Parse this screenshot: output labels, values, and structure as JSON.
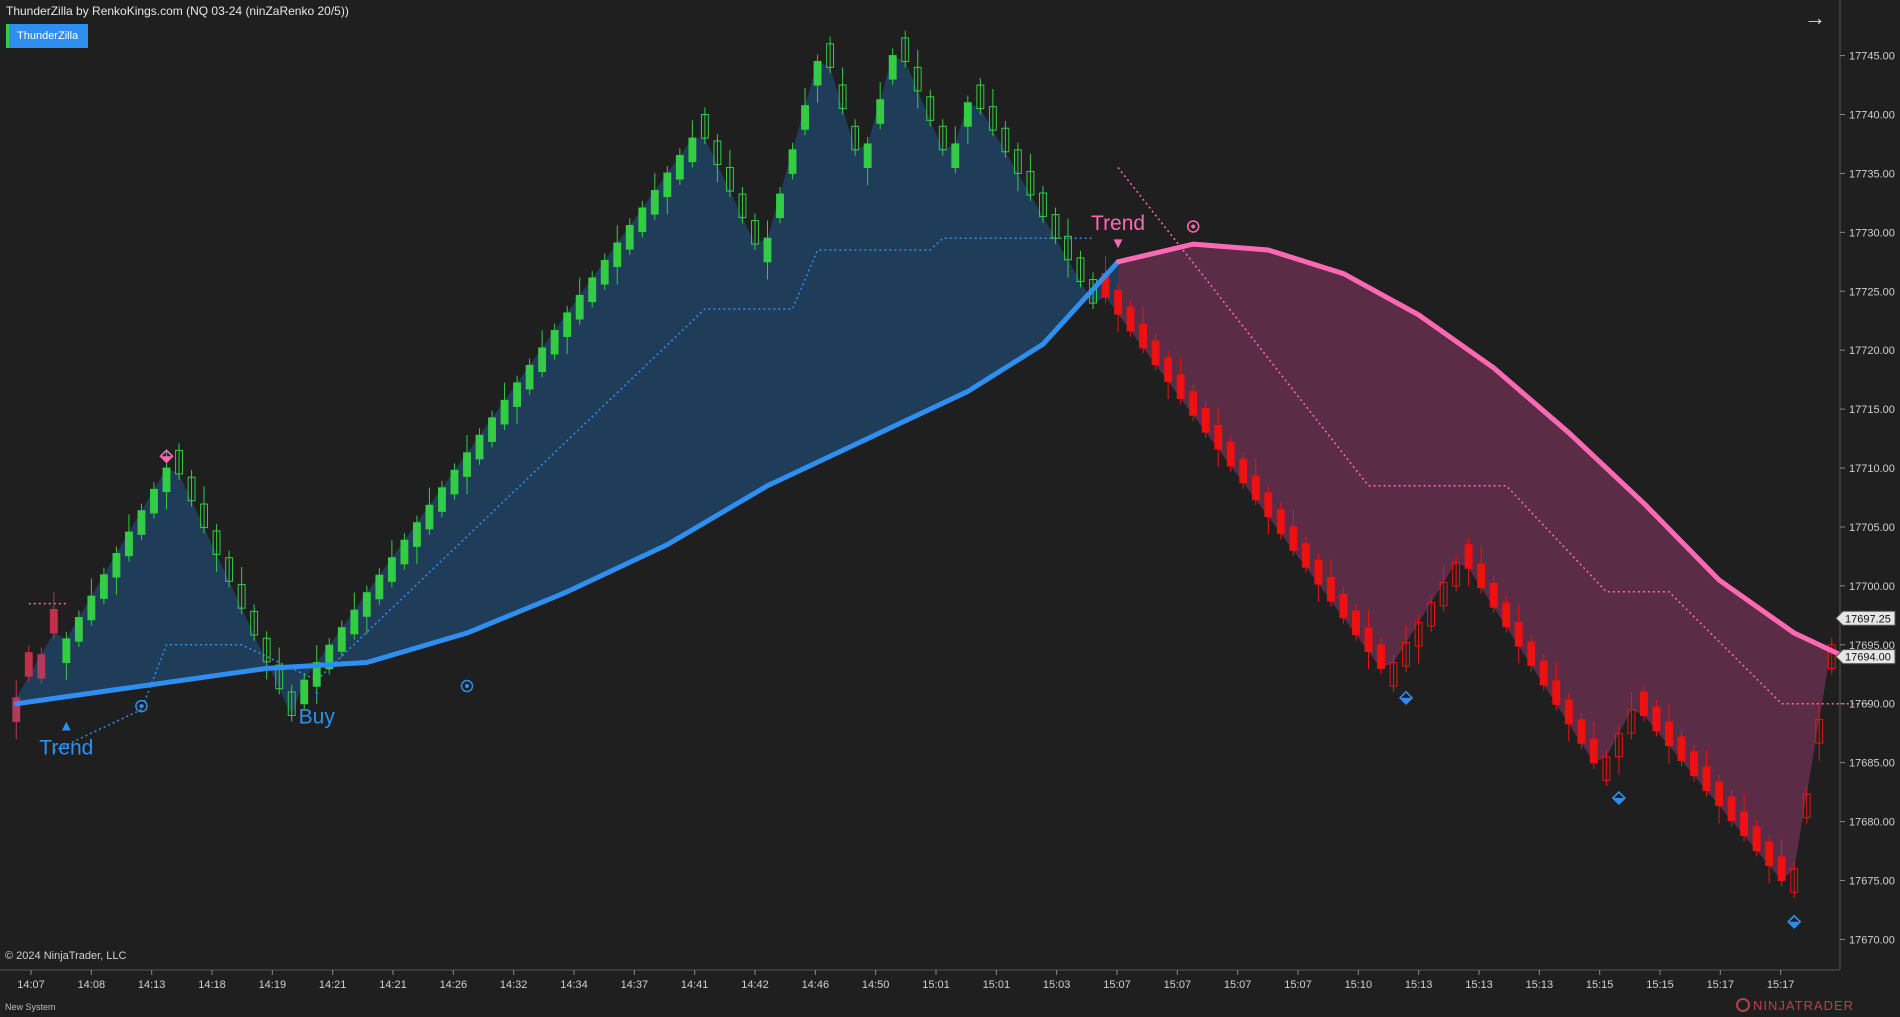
{
  "header": {
    "title": "ThunderZilla by RenkoKings.com (NQ 03-24 (ninZaRenko 20/5))",
    "indicator_badge": "ThunderZilla"
  },
  "footer": {
    "copyright": "© 2024 NinjaTrader, LLC",
    "system": "New System",
    "logo": "NINJATRADER"
  },
  "colors": {
    "background": "#1f1f1f",
    "up_bar": "#33cc44",
    "down_bar": "#ee1111",
    "bull_line": "#2f8ff0",
    "bear_line": "#ff69b4",
    "bull_fill": "#1f4468",
    "bear_fill": "#6a3050"
  },
  "chart_data": {
    "type": "candlestick-renko",
    "y_axis": {
      "ticks": [
        17745.0,
        17740.0,
        17735.0,
        17730.0,
        17725.0,
        17720.0,
        17715.0,
        17710.0,
        17705.0,
        17700.0,
        17695.0,
        17690.0,
        17685.0,
        17680.0,
        17675.0,
        17670.0
      ],
      "ylim": [
        17668.0,
        17747.0
      ]
    },
    "price_labels": [
      {
        "value": 17697.25,
        "text": "17697.25"
      },
      {
        "value": 17694.0,
        "text": "17694.00"
      }
    ],
    "x_axis": {
      "tick_labels": [
        "14:07",
        "14:08",
        "14:13",
        "14:18",
        "14:19",
        "14:21",
        "14:21",
        "14:26",
        "14:32",
        "14:34",
        "14:37",
        "14:41",
        "14:42",
        "14:46",
        "14:50",
        "15:01",
        "15:01",
        "15:03",
        "15:07",
        "15:07",
        "15:07",
        "15:07",
        "15:10",
        "15:13",
        "15:13",
        "15:13",
        "15:15",
        "15:15",
        "15:17",
        "15:17"
      ]
    },
    "bars": {
      "count": 146,
      "segments": [
        {
          "from": 0,
          "to": 3,
          "start": 17690.5,
          "end": 17696.0,
          "dir": "mix"
        },
        {
          "from": 4,
          "to": 12,
          "start": 17695.5,
          "end": 17710.0,
          "dir": "up"
        },
        {
          "from": 13,
          "to": 22,
          "start": 17709.5,
          "end": 17689.0,
          "dir": "down-hollow"
        },
        {
          "from": 23,
          "to": 54,
          "start": 17692.0,
          "end": 17738.0,
          "dir": "up"
        },
        {
          "from": 55,
          "to": 59,
          "start": 17738.0,
          "end": 17729.0,
          "dir": "down-hollow"
        },
        {
          "from": 60,
          "to": 64,
          "start": 17729.5,
          "end": 17744.5,
          "dir": "up"
        },
        {
          "from": 65,
          "to": 67,
          "start": 17744.0,
          "end": 17737.0,
          "dir": "down-hollow"
        },
        {
          "from": 68,
          "to": 70,
          "start": 17737.5,
          "end": 17745.0,
          "dir": "up"
        },
        {
          "from": 71,
          "to": 74,
          "start": 17744.5,
          "end": 17737.0,
          "dir": "down-hollow"
        },
        {
          "from": 75,
          "to": 76,
          "start": 17737.5,
          "end": 17741.0,
          "dir": "up"
        },
        {
          "from": 77,
          "to": 86,
          "start": 17740.5,
          "end": 17724.0,
          "dir": "down-hollow"
        },
        {
          "from": 87,
          "to": 109,
          "start": 17724.5,
          "end": 17693.0,
          "dir": "down"
        },
        {
          "from": 110,
          "to": 115,
          "start": 17693.5,
          "end": 17702.0,
          "dir": "up-hollow-red"
        },
        {
          "from": 116,
          "to": 126,
          "start": 17701.5,
          "end": 17685.0,
          "dir": "down"
        },
        {
          "from": 127,
          "to": 129,
          "start": 17685.5,
          "end": 17689.5,
          "dir": "up-hollow-red"
        },
        {
          "from": 130,
          "to": 141,
          "start": 17689.0,
          "end": 17675.0,
          "dir": "down"
        },
        {
          "from": 142,
          "to": 145,
          "start": 17676.0,
          "end": 17695.0,
          "dir": "up-hollow-red"
        }
      ]
    },
    "trend_line": {
      "bull": {
        "from_bar": 0,
        "to_bar": 88,
        "points": [
          [
            0,
            17690.0
          ],
          [
            10,
            17691.5
          ],
          [
            20,
            17693.0
          ],
          [
            28,
            17693.5
          ],
          [
            36,
            17696.0
          ],
          [
            44,
            17699.5
          ],
          [
            52,
            17703.5
          ],
          [
            60,
            17708.5
          ],
          [
            68,
            17712.5
          ],
          [
            76,
            17716.5
          ],
          [
            82,
            17720.5
          ],
          [
            88,
            17727.5
          ]
        ]
      },
      "bear": {
        "from_bar": 88,
        "to_bar": 146,
        "points": [
          [
            88,
            17727.5
          ],
          [
            94,
            17729.0
          ],
          [
            100,
            17728.5
          ],
          [
            106,
            17726.5
          ],
          [
            112,
            17723.0
          ],
          [
            118,
            17718.5
          ],
          [
            124,
            17713.0
          ],
          [
            130,
            17707.0
          ],
          [
            136,
            17700.5
          ],
          [
            142,
            17696.0
          ],
          [
            146,
            17694.0
          ]
        ]
      }
    },
    "stop_lines": {
      "bull_dotted": [
        [
          3,
          17686.0
        ],
        [
          10,
          17689.5
        ],
        [
          12,
          17695.0
        ],
        [
          18,
          17695.0
        ],
        [
          24,
          17692.0
        ],
        [
          55,
          17723.5
        ],
        [
          62,
          17723.5
        ],
        [
          64,
          17728.5
        ],
        [
          73,
          17728.5
        ],
        [
          74,
          17729.5
        ],
        [
          86,
          17729.5
        ]
      ],
      "bear_dotted": [
        [
          88,
          17735.5
        ],
        [
          108,
          17708.5
        ],
        [
          119,
          17708.5
        ],
        [
          127,
          17699.5
        ],
        [
          132,
          17699.5
        ],
        [
          141,
          17690.0
        ],
        [
          148,
          17690.0
        ]
      ],
      "short_pink": [
        [
          1,
          17698.5
        ],
        [
          4,
          17698.5
        ]
      ]
    },
    "signals": [
      {
        "label": "Trend",
        "bar": 4,
        "direction": "up",
        "color": "#2f8ff0"
      },
      {
        "label": "Buy",
        "bar": 24,
        "direction": "up",
        "color": "#2f8ff0"
      },
      {
        "label": "Trend",
        "bar": 88,
        "direction": "down",
        "color": "#ff69b4"
      }
    ],
    "markers": [
      {
        "bar": 12,
        "value": 17711.0,
        "shape": "diamond",
        "color": "#ff69b4"
      },
      {
        "bar": 10,
        "value": 17689.8,
        "shape": "circle",
        "color": "#2f8ff0"
      },
      {
        "bar": 36,
        "value": 17691.5,
        "shape": "circle",
        "color": "#2f8ff0"
      },
      {
        "bar": 94,
        "value": 17730.5,
        "shape": "circle",
        "color": "#ff69b4"
      },
      {
        "bar": 111,
        "value": 17690.5,
        "shape": "diamond",
        "color": "#2f8ff0"
      },
      {
        "bar": 128,
        "value": 17682.0,
        "shape": "diamond",
        "color": "#2f8ff0"
      },
      {
        "bar": 142,
        "value": 17671.5,
        "shape": "diamond",
        "color": "#2f8ff0"
      }
    ]
  }
}
